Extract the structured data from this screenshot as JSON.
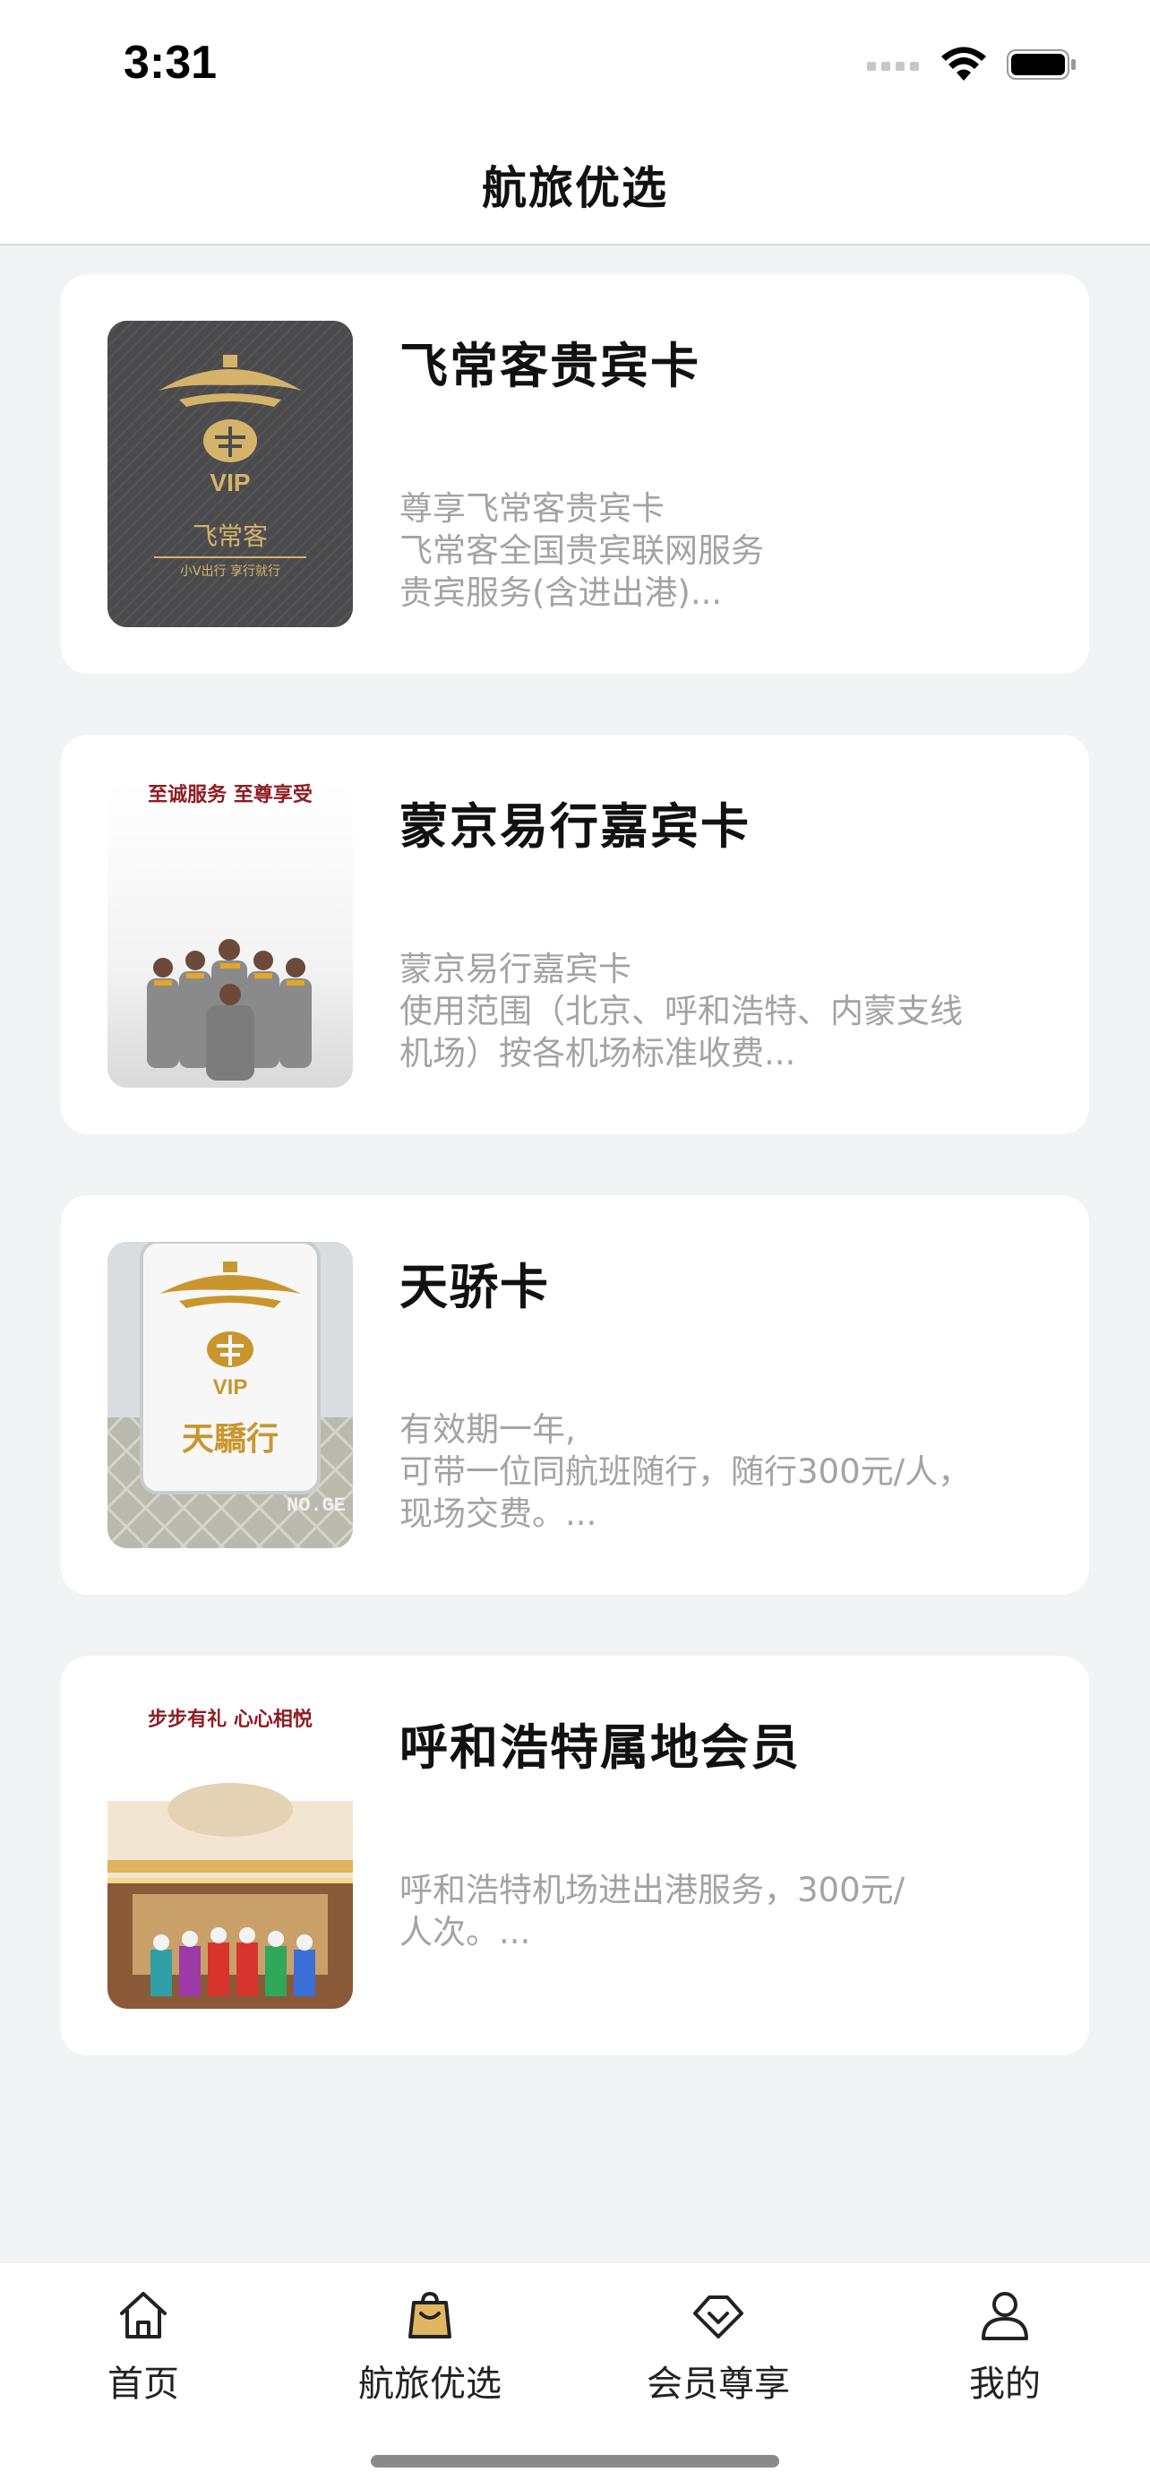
{
  "status_bar": {
    "time": "3:31"
  },
  "nav": {
    "title": "航旅优选"
  },
  "cards": [
    {
      "title": "飞常客贵宾卡",
      "desc": [
        "尊享飞常客贵宾卡",
        "飞常客全国贵宾联网服务",
        "贵宾服务(含进出港)..."
      ],
      "image_text": {
        "vip": "VIP",
        "name": "飞常客",
        "sub": "小V出行  享行就行"
      }
    },
    {
      "title": "蒙京易行嘉宾卡",
      "desc": [
        "蒙京易行嘉宾卡",
        "使用范围（北京、呼和浩特、内蒙支线",
        "机场）按各机场标准收费..."
      ],
      "image_text": {
        "banner": "至诚服务 至尊享受"
      }
    },
    {
      "title": "天骄卡",
      "desc": [
        "有效期一年,",
        "可带一位同航班随行，随行300元/人，",
        "现场交费。..."
      ],
      "image_text": {
        "vip": "VIP",
        "name": "天驕行",
        "code": "NO.GE"
      }
    },
    {
      "title": "呼和浩特属地会员",
      "desc": [
        "呼和浩特机场进出港服务，300元/",
        "人次。..."
      ],
      "image_text": {
        "banner": "步步有礼 心心相悦"
      }
    }
  ],
  "tab_bar": {
    "active_color": "#e0b661",
    "tabs": [
      {
        "label": "首页",
        "icon": "home-icon"
      },
      {
        "label": "航旅优选",
        "icon": "shopping-bag-icon"
      },
      {
        "label": "会员尊享",
        "icon": "diamond-icon"
      },
      {
        "label": "我的",
        "icon": "user-icon"
      }
    ]
  }
}
